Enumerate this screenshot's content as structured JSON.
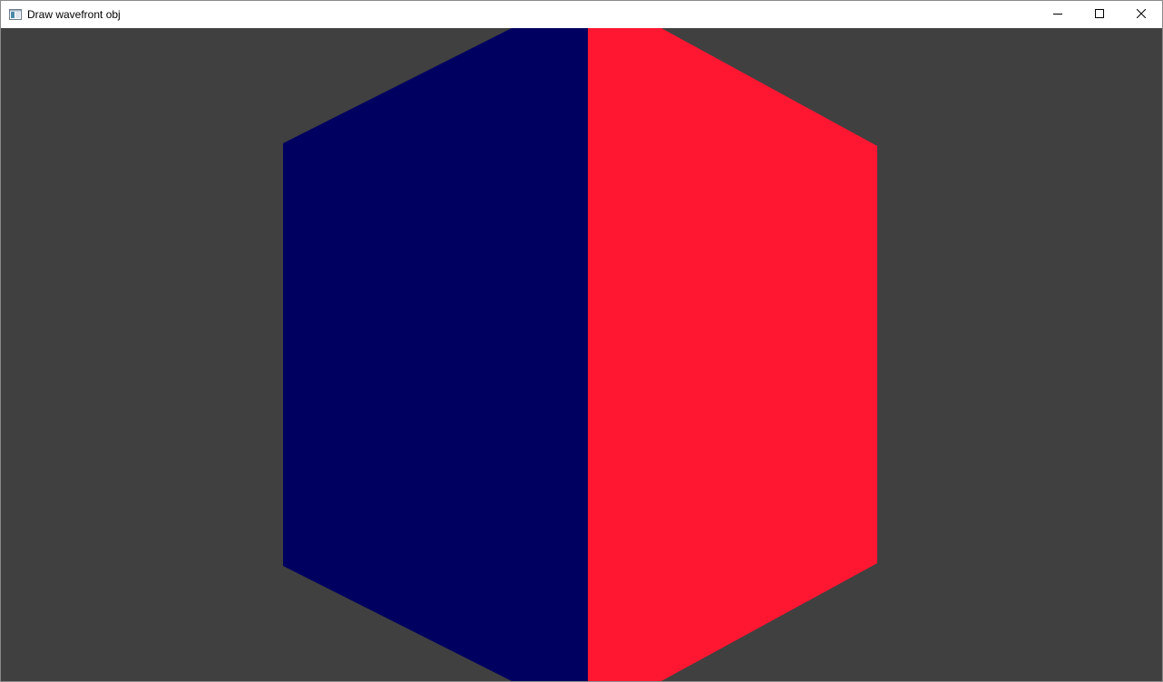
{
  "window": {
    "title": "Draw wavefront obj",
    "app_icon": "window-app-icon",
    "controls": {
      "minimize": "minimize-icon",
      "maximize": "maximize-icon",
      "close": "close-icon"
    }
  },
  "viewport": {
    "background_color": "#404040",
    "faces": [
      {
        "name": "left-face",
        "color": "#000060"
      },
      {
        "name": "right-face",
        "color": "#ff1732"
      }
    ]
  }
}
